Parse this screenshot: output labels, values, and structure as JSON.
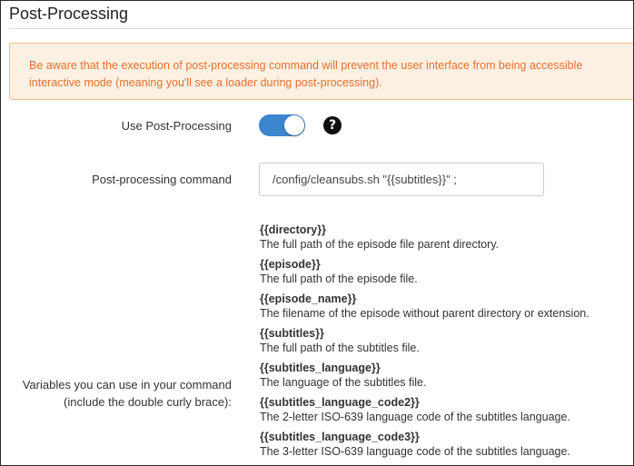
{
  "section": {
    "title": "Post-Processing"
  },
  "alert": {
    "text_line1": "Be aware that the execution of post-processing command will prevent the user interface from being accessible",
    "text_line2": "interactive mode (meaning you'll see a loader during post-processing)."
  },
  "use_post_processing": {
    "label": "Use Post-Processing",
    "enabled": true,
    "toggle_color": "#3c85cf",
    "help_icon": "question-circle-icon",
    "help_glyph": "?"
  },
  "command": {
    "label": "Post-processing command",
    "value": "/config/cleansubs.sh \"{{subtitles}}\" ;"
  },
  "variables": {
    "label_line1": "Variables you can use in your command",
    "label_line2": "(include the double curly brace):",
    "items": [
      {
        "name": "{{directory}}",
        "description": "The full path of the episode file parent directory."
      },
      {
        "name": "{{episode}}",
        "description": "The full path of the episode file."
      },
      {
        "name": "{{episode_name}}",
        "description": "The filename of the episode without parent directory or extension."
      },
      {
        "name": "{{subtitles}}",
        "description": "The full path of the subtitles file."
      },
      {
        "name": "{{subtitles_language}}",
        "description": "The language of the subtitles file."
      },
      {
        "name": "{{subtitles_language_code2}}",
        "description": "The 2-letter ISO-639 language code of the subtitles language."
      },
      {
        "name": "{{subtitles_language_code3}}",
        "description": "The 3-letter ISO-639 language code of the subtitles language."
      }
    ]
  },
  "colors": {
    "alert_text": "#e8702a",
    "alert_bg": "#fcf0e3",
    "alert_border": "#f2b98a"
  }
}
